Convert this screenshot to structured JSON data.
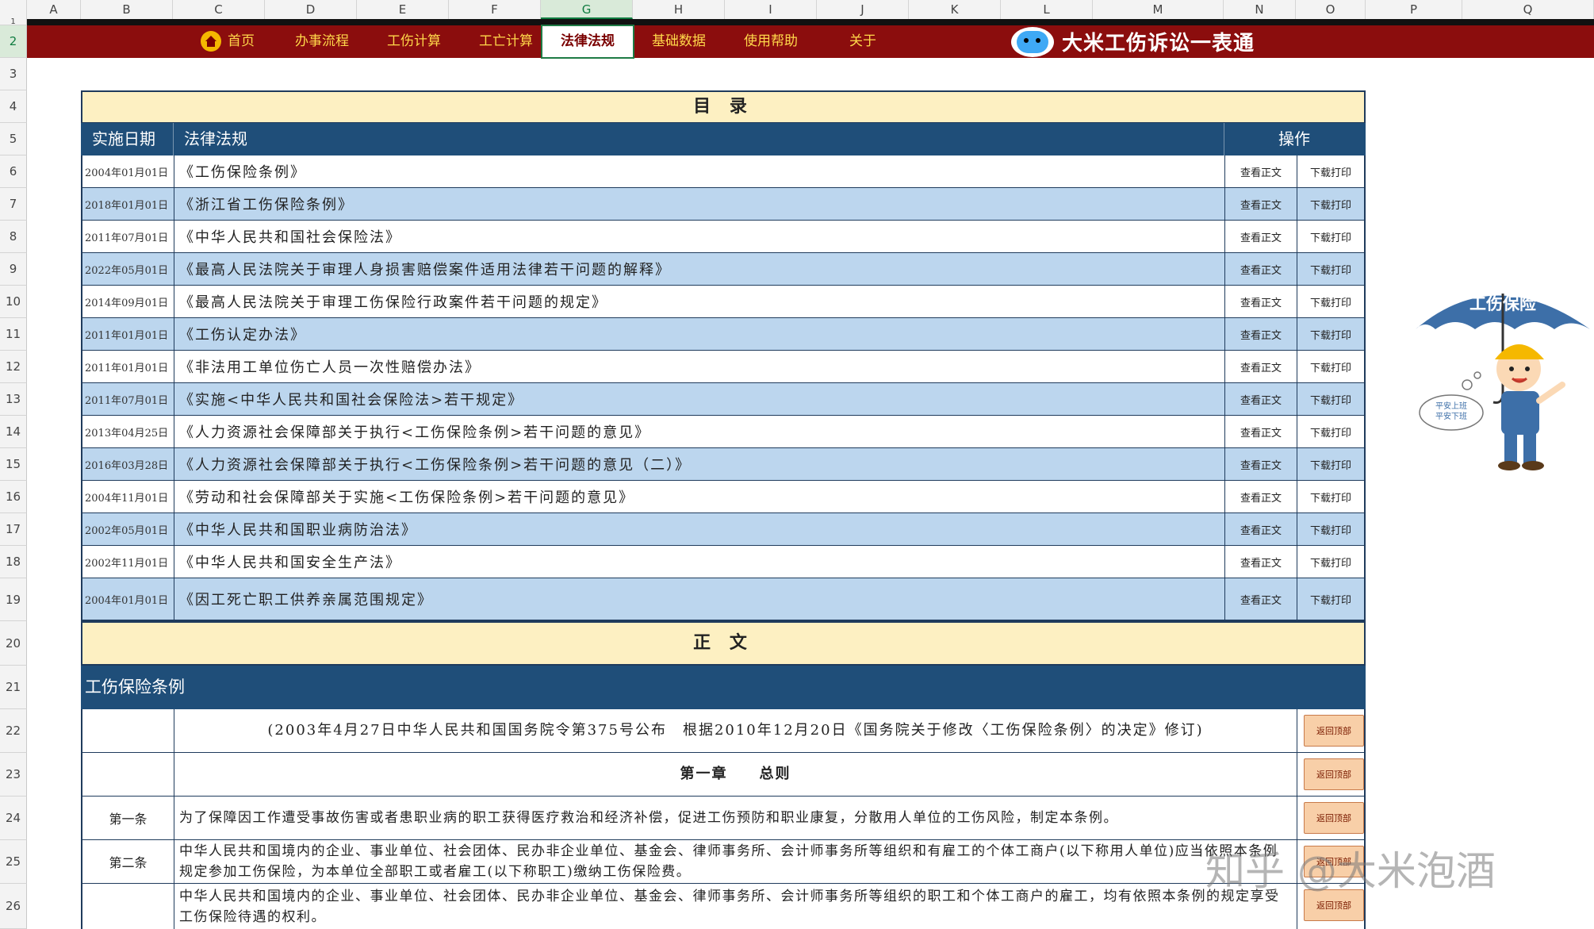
{
  "spreadsheet": {
    "columns": [
      "A",
      "B",
      "C",
      "D",
      "E",
      "F",
      "G",
      "H",
      "I",
      "J",
      "K",
      "L",
      "M",
      "N",
      "O",
      "P",
      "Q"
    ],
    "rows": [
      "1",
      "2",
      "3",
      "4",
      "5",
      "6",
      "7",
      "8",
      "9",
      "10",
      "11",
      "12",
      "13",
      "14",
      "15",
      "16",
      "17",
      "18",
      "19",
      "20",
      "21",
      "22",
      "23",
      "24",
      "25",
      "26"
    ]
  },
  "nav": {
    "items": [
      "首页",
      "办事流程",
      "工伤计算",
      "工亡计算",
      "法律法规",
      "基础数据",
      "使用帮助",
      "关于"
    ],
    "brand_title": "大米工伤诉讼一表通",
    "icons": [
      "home-icon",
      "brand-logo-icon"
    ]
  },
  "catalog": {
    "title": "目 录",
    "headers": {
      "date": "实施日期",
      "law": "法律法规",
      "ops": "操作"
    },
    "view_label": "查看正文",
    "download_label": "下载打印",
    "rows": [
      {
        "date": "2004年01月01日",
        "law": "《工伤保险条例》"
      },
      {
        "date": "2018年01月01日",
        "law": "《浙江省工伤保险条例》"
      },
      {
        "date": "2011年07月01日",
        "law": "《中华人民共和国社会保险法》"
      },
      {
        "date": "2022年05月01日",
        "law": "《最高人民法院关于审理人身损害赔偿案件适用法律若干问题的解释》"
      },
      {
        "date": "2014年09月01日",
        "law": "《最高人民法院关于审理工伤保险行政案件若干问题的规定》"
      },
      {
        "date": "2011年01月01日",
        "law": "《工伤认定办法》"
      },
      {
        "date": "2011年01月01日",
        "law": "《非法用工单位伤亡人员一次性赔偿办法》"
      },
      {
        "date": "2011年07月01日",
        "law": "《实施<中华人民共和国社会保险法>若干规定》"
      },
      {
        "date": "2013年04月25日",
        "law": "《人力资源社会保障部关于执行<工伤保险条例>若干问题的意见》"
      },
      {
        "date": "2016年03月28日",
        "law": "《人力资源社会保障部关于执行<工伤保险条例>若干问题的意见（二）》"
      },
      {
        "date": "2004年11月01日",
        "law": "《劳动和社会保障部关于实施<工伤保险条例>若干问题的意见》"
      },
      {
        "date": "2002年05月01日",
        "law": "《中华人民共和国职业病防治法》"
      },
      {
        "date": "2002年11月01日",
        "law": "《中华人民共和国安全生产法》"
      },
      {
        "date": "2004年01月01日",
        "law": "《因工死亡职工供养亲属范围规定》"
      }
    ]
  },
  "body": {
    "title": "正 文",
    "section_title": "工伤保险条例",
    "back_top_label": "返回顶部",
    "rows": [
      {
        "article": "",
        "text": "(2003年4月27日中华人民共和国国务院令第375号公布　根据2010年12月20日《国务院关于修改〈工伤保险条例〉的决定》修订)"
      },
      {
        "article": "",
        "text": "第一章　　总则"
      },
      {
        "article": "第一条",
        "text": "为了保障因工作遭受事故伤害或者患职业病的职工获得医疗救治和经济补偿，促进工伤预防和职业康复，分散用人单位的工伤风险，制定本条例。"
      },
      {
        "article": "第二条",
        "text": "中华人民共和国境内的企业、事业单位、社会团体、民办非企业单位、基金会、律师事务所、会计师事务所等组织和有雇工的个体工商户(以下称用人单位)应当依照本条例规定参加工伤保险，为本单位全部职工或者雇工(以下称职工)缴纳工伤保险费。"
      },
      {
        "article": "",
        "text": "中华人民共和国境内的企业、事业单位、社会团体、民办非企业单位、基金会、律师事务所、会计师事务所等组织的职工和个体工商户的雇工，均有依照本条例的规定享受工伤保险待遇的权利。"
      }
    ]
  },
  "mascot": {
    "umbrella_text": "工伤保险",
    "bubble_line1": "平安上班",
    "bubble_line2": "平安下班"
  },
  "watermark": "知乎 @大米泡酒"
}
